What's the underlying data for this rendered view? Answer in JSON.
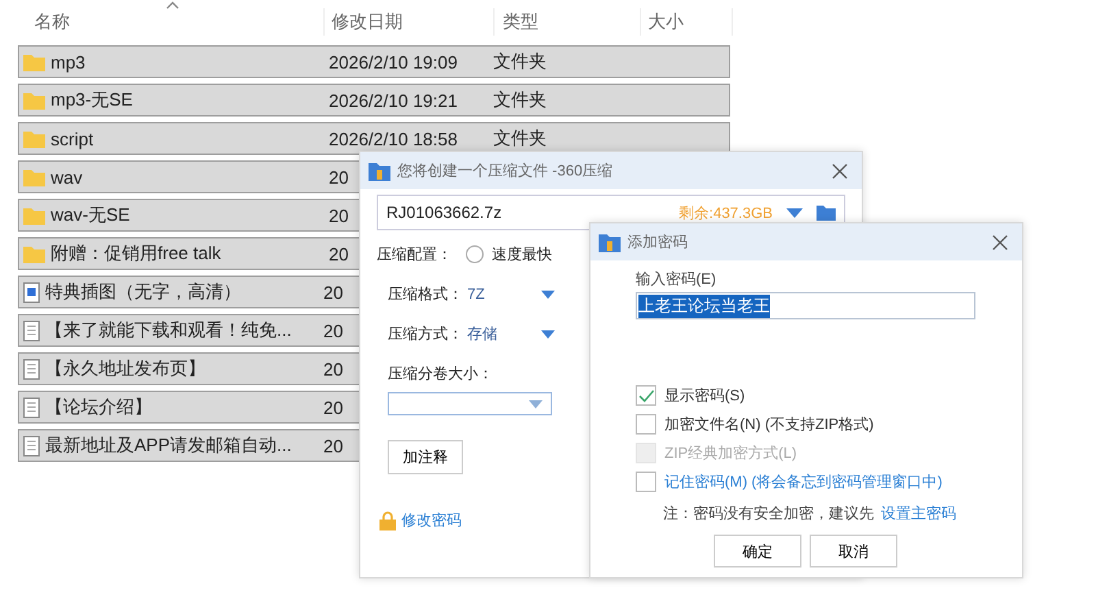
{
  "explorer": {
    "columns": [
      "名称",
      "修改日期",
      "类型",
      "大小"
    ],
    "rows": [
      {
        "kind": "folder",
        "name": "mp3",
        "date": "2026/2/10 19:09",
        "type": "文件夹",
        "selected": true
      },
      {
        "kind": "folder",
        "name": "mp3-无SE",
        "date": "2026/2/10 19:21",
        "type": "文件夹",
        "selected": true
      },
      {
        "kind": "folder",
        "name": "script",
        "date": "2026/2/10 18:58",
        "type": "文件夹",
        "selected": true
      },
      {
        "kind": "folder",
        "name": "wav",
        "date": "20",
        "selected": true
      },
      {
        "kind": "folder",
        "name": "wav-无SE",
        "date": "20",
        "selected": true
      },
      {
        "kind": "folder",
        "name": "附赠：促销用free talk",
        "date": "20",
        "selected": true
      },
      {
        "kind": "image",
        "name": "特典插图（无字，高清）",
        "date": "20",
        "selected": true
      },
      {
        "kind": "text",
        "name": "【来了就能下载和观看！纯免...",
        "date": "20",
        "selected": true
      },
      {
        "kind": "text",
        "name": "【永久地址发布页】",
        "date": "20",
        "selected": true
      },
      {
        "kind": "text",
        "name": "【论坛介绍】",
        "date": "20",
        "selected": true
      },
      {
        "kind": "text",
        "name": "最新地址及APP请发邮箱自动...",
        "date": "20",
        "selected": true
      }
    ]
  },
  "compress_dialog": {
    "title": "您将创建一个压缩文件 -360压缩",
    "filename": "RJ01063662.7z",
    "free_space": "剩余:437.3GB",
    "config_label": "压缩配置：",
    "config_option": {
      "label": "速度最快",
      "selected": false
    },
    "fields": [
      {
        "label": "压缩格式：",
        "value": "7Z"
      },
      {
        "label": "压缩方式：",
        "value": "存储"
      }
    ],
    "split_label": "压缩分卷大小：",
    "comment_button": "加注释",
    "change_password_link": "修改密码"
  },
  "password_dialog": {
    "title": "添加密码",
    "input_label": "输入密码(E)",
    "password": "上老王论坛当老王",
    "options": [
      {
        "kind": "plain",
        "label": "显示密码(S)",
        "checked": true,
        "disabled": false
      },
      {
        "kind": "plain",
        "label": "加密文件名(N) (不支持ZIP格式)",
        "checked": false,
        "disabled": false
      },
      {
        "kind": "plain",
        "label": "ZIP经典加密方式(L)",
        "checked": false,
        "disabled": true
      },
      {
        "kind": "link",
        "label": "记住密码(M) (将会备忘到密码管理窗口中)",
        "checked": false,
        "disabled": false
      }
    ],
    "note": "注：密码没有安全加密，建议先",
    "note_link": "设置主密码",
    "buttons": [
      "确定",
      "取消"
    ]
  }
}
